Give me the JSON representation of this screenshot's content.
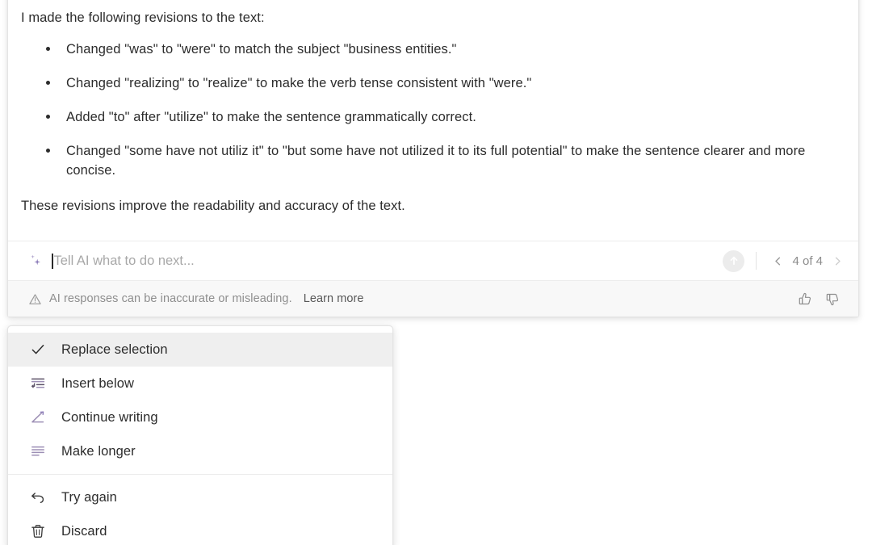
{
  "colors": {
    "accent_purple": "#8b7bb8",
    "text_primary": "#2c2c2c",
    "text_muted": "#8e8e8e",
    "panel_bg": "#ffffff",
    "footer_bg": "#f8f8f8",
    "menu_highlight": "#efefef",
    "send_button_bg": "#ececec"
  },
  "ai_panel": {
    "response": {
      "intro": "I made the following revisions to the text:",
      "bullets": [
        "Changed \"was\" to \"were\" to match the subject \"business entities.\"",
        "Changed \"realizing\" to \"realize\" to make the verb tense consistent with \"were.\"",
        "Added \"to\" after \"utilize\" to make the sentence grammatically correct.",
        "Changed \"some have not utiliz it\" to \"but some have not utilized it to its full potential\" to make the sentence clearer and more concise."
      ],
      "closing": "These revisions improve the readability and accuracy of the text."
    },
    "prompt": {
      "icon": "sparkle-icon",
      "value": "",
      "placeholder": "Tell AI what to do next...",
      "send_icon": "arrow-up-circle-icon",
      "send_label": "Send"
    },
    "pager": {
      "prev_icon": "chevron-left-icon",
      "next_icon": "chevron-right-icon",
      "label": "4 of 4",
      "current": 4,
      "total": 4
    },
    "footer": {
      "warning_icon": "warning-triangle-icon",
      "disclaimer": "AI responses can be inaccurate or misleading.",
      "learn_more": "Learn more",
      "thumbs_up_icon": "thumbs-up-icon",
      "thumbs_down_icon": "thumbs-down-icon"
    }
  },
  "action_menu": {
    "items": [
      {
        "label": "Replace selection",
        "icon": "check-icon",
        "selected": true
      },
      {
        "label": "Insert below",
        "icon": "insert-below-icon",
        "selected": false
      },
      {
        "label": "Continue writing",
        "icon": "pencil-line-icon",
        "selected": false
      },
      {
        "label": "Make longer",
        "icon": "make-longer-lines-icon",
        "selected": false
      }
    ],
    "secondary_items": [
      {
        "label": "Try again",
        "icon": "undo-arrow-icon"
      },
      {
        "label": "Discard",
        "icon": "trash-icon"
      }
    ]
  }
}
